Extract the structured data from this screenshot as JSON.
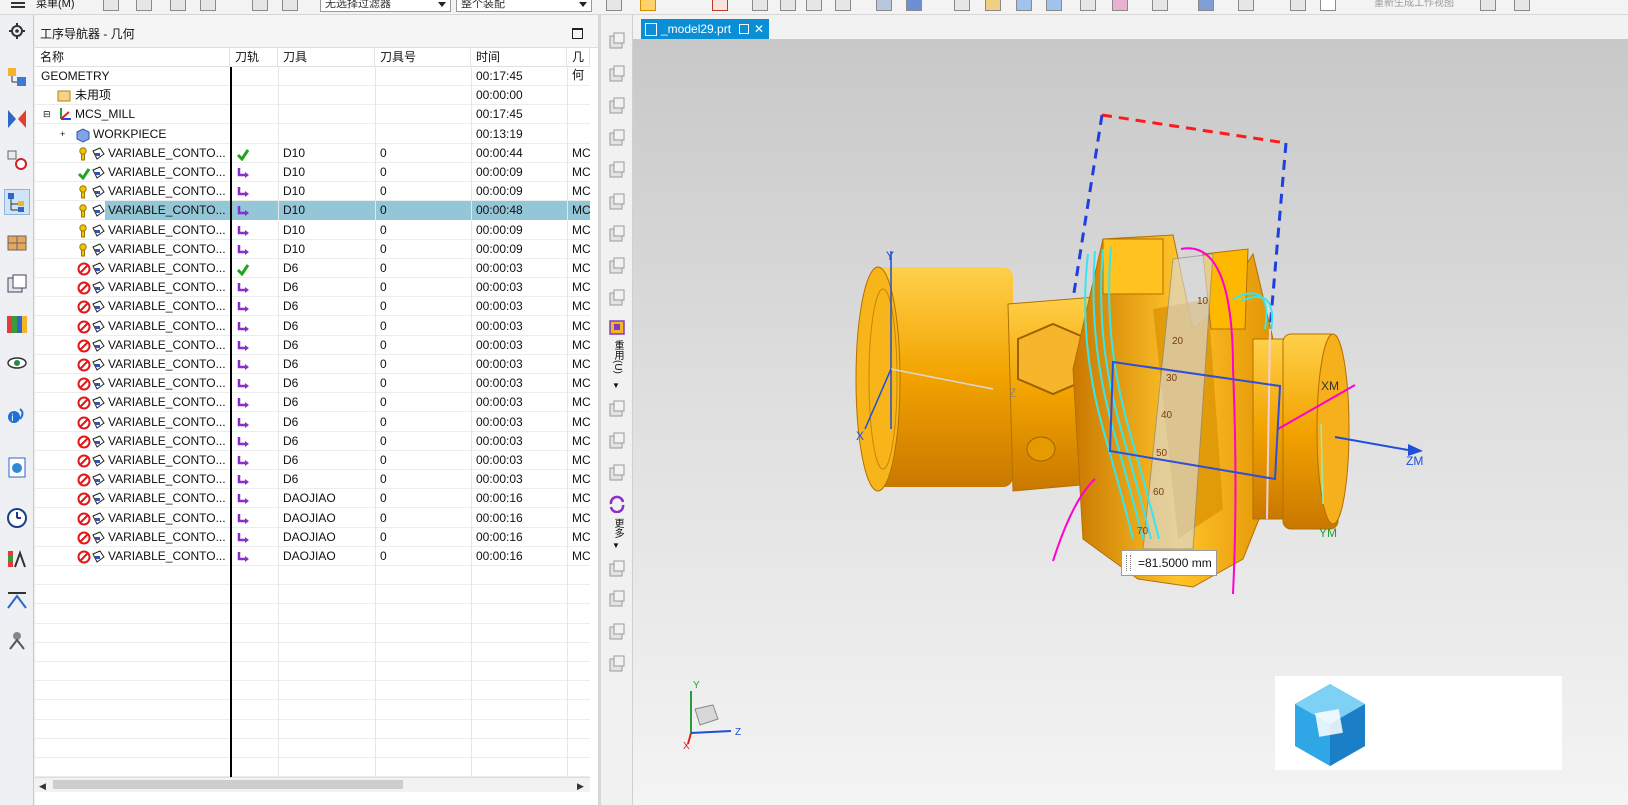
{
  "toolbar": {
    "menu_label": "菜单(M)",
    "filter_select": "无选择过滤器",
    "assembly_select": "整个装配",
    "right_hint": "重新生成工作视图"
  },
  "navigator": {
    "title": "工序导航器 - 几何",
    "columns": [
      "名称",
      "刀轨",
      "刀具",
      "刀具号",
      "时间",
      "几何"
    ],
    "rows": [
      {
        "name": "GEOMETRY",
        "path": "",
        "tool": "",
        "toolno": "",
        "time": "00:17:45",
        "geom": "",
        "level": 0,
        "status": "",
        "type": "root"
      },
      {
        "name": "未用项",
        "path": "",
        "tool": "",
        "toolno": "",
        "time": "00:00:00",
        "geom": "",
        "level": 1,
        "status": "",
        "type": "unused"
      },
      {
        "name": "MCS_MILL",
        "path": "",
        "tool": "",
        "toolno": "",
        "time": "00:17:45",
        "geom": "",
        "level": 1,
        "status": "",
        "type": "mcs"
      },
      {
        "name": "WORKPIECE",
        "path": "",
        "tool": "",
        "toolno": "",
        "time": "00:13:19",
        "geom": "",
        "level": 2,
        "status": "",
        "type": "workpiece"
      },
      {
        "name": "VARIABLE_CONTO...",
        "path": "check",
        "tool": "D10",
        "toolno": "0",
        "time": "00:00:44",
        "geom": "MC",
        "level": 3,
        "status": "warn",
        "type": "op"
      },
      {
        "name": "VARIABLE_CONTO...",
        "path": "arrow",
        "tool": "D10",
        "toolno": "0",
        "time": "00:00:09",
        "geom": "MC",
        "level": 3,
        "status": "ok",
        "type": "op"
      },
      {
        "name": "VARIABLE_CONTO...",
        "path": "arrow",
        "tool": "D10",
        "toolno": "0",
        "time": "00:00:09",
        "geom": "MC",
        "level": 3,
        "status": "warn",
        "type": "op"
      },
      {
        "name": "VARIABLE_CONTO...",
        "path": "arrow",
        "tool": "D10",
        "toolno": "0",
        "time": "00:00:48",
        "geom": "MC",
        "level": 3,
        "status": "warn",
        "type": "op",
        "selected": true
      },
      {
        "name": "VARIABLE_CONTO...",
        "path": "arrow",
        "tool": "D10",
        "toolno": "0",
        "time": "00:00:09",
        "geom": "MC",
        "level": 3,
        "status": "warn",
        "type": "op"
      },
      {
        "name": "VARIABLE_CONTO...",
        "path": "arrow",
        "tool": "D10",
        "toolno": "0",
        "time": "00:00:09",
        "geom": "MC",
        "level": 3,
        "status": "warn",
        "type": "op"
      },
      {
        "name": "VARIABLE_CONTO...",
        "path": "check",
        "tool": "D6",
        "toolno": "0",
        "time": "00:00:03",
        "geom": "MC",
        "level": 3,
        "status": "no",
        "type": "op"
      },
      {
        "name": "VARIABLE_CONTO...",
        "path": "arrow",
        "tool": "D6",
        "toolno": "0",
        "time": "00:00:03",
        "geom": "MC",
        "level": 3,
        "status": "no",
        "type": "op"
      },
      {
        "name": "VARIABLE_CONTO...",
        "path": "arrow",
        "tool": "D6",
        "toolno": "0",
        "time": "00:00:03",
        "geom": "MC",
        "level": 3,
        "status": "no",
        "type": "op"
      },
      {
        "name": "VARIABLE_CONTO...",
        "path": "arrow",
        "tool": "D6",
        "toolno": "0",
        "time": "00:00:03",
        "geom": "MC",
        "level": 3,
        "status": "no",
        "type": "op"
      },
      {
        "name": "VARIABLE_CONTO...",
        "path": "arrow",
        "tool": "D6",
        "toolno": "0",
        "time": "00:00:03",
        "geom": "MC",
        "level": 3,
        "status": "no",
        "type": "op"
      },
      {
        "name": "VARIABLE_CONTO...",
        "path": "arrow",
        "tool": "D6",
        "toolno": "0",
        "time": "00:00:03",
        "geom": "MC",
        "level": 3,
        "status": "no",
        "type": "op"
      },
      {
        "name": "VARIABLE_CONTO...",
        "path": "arrow",
        "tool": "D6",
        "toolno": "0",
        "time": "00:00:03",
        "geom": "MC",
        "level": 3,
        "status": "no",
        "type": "op"
      },
      {
        "name": "VARIABLE_CONTO...",
        "path": "arrow",
        "tool": "D6",
        "toolno": "0",
        "time": "00:00:03",
        "geom": "MC",
        "level": 3,
        "status": "no",
        "type": "op"
      },
      {
        "name": "VARIABLE_CONTO...",
        "path": "arrow",
        "tool": "D6",
        "toolno": "0",
        "time": "00:00:03",
        "geom": "MC",
        "level": 3,
        "status": "no",
        "type": "op"
      },
      {
        "name": "VARIABLE_CONTO...",
        "path": "arrow",
        "tool": "D6",
        "toolno": "0",
        "time": "00:00:03",
        "geom": "MC",
        "level": 3,
        "status": "no",
        "type": "op"
      },
      {
        "name": "VARIABLE_CONTO...",
        "path": "arrow",
        "tool": "D6",
        "toolno": "0",
        "time": "00:00:03",
        "geom": "MC",
        "level": 3,
        "status": "no",
        "type": "op"
      },
      {
        "name": "VARIABLE_CONTO...",
        "path": "arrow",
        "tool": "D6",
        "toolno": "0",
        "time": "00:00:03",
        "geom": "MC",
        "level": 3,
        "status": "no",
        "type": "op"
      },
      {
        "name": "VARIABLE_CONTO...",
        "path": "arrow",
        "tool": "DAOJIAO",
        "toolno": "0",
        "time": "00:00:16",
        "geom": "MC",
        "level": 3,
        "status": "no",
        "type": "op"
      },
      {
        "name": "VARIABLE_CONTO...",
        "path": "arrow",
        "tool": "DAOJIAO",
        "toolno": "0",
        "time": "00:00:16",
        "geom": "MC",
        "level": 3,
        "status": "no",
        "type": "op"
      },
      {
        "name": "VARIABLE_CONTO...",
        "path": "arrow",
        "tool": "DAOJIAO",
        "toolno": "0",
        "time": "00:00:16",
        "geom": "MC",
        "level": 3,
        "status": "no",
        "type": "op"
      },
      {
        "name": "VARIABLE_CONTO...",
        "path": "arrow",
        "tool": "DAOJIAO",
        "toolno": "0",
        "time": "00:00:16",
        "geom": "MC",
        "level": 3,
        "status": "no",
        "type": "op"
      }
    ]
  },
  "side_toolbar": {
    "group1_label": "重用(U)",
    "group2_label": "更多"
  },
  "viewport": {
    "tab_label": "_model29.prt",
    "measure_value": "=81.5000 mm",
    "axis_labels": {
      "xm": "XM",
      "ym": "YM",
      "zm": "ZM",
      "y": "Y",
      "x": "X",
      "z": "Z"
    },
    "triad_labels": {
      "x": "X",
      "y": "Y",
      "z": "Z"
    },
    "ruler_ticks": [
      "10",
      "20",
      "30",
      "40",
      "50",
      "60",
      "70"
    ]
  },
  "colors": {
    "selected_row": "#93c7d8",
    "tab_active": "#0a8fd6",
    "part_orange": "#f2a300",
    "toolpath_cyan": "#35e6f0",
    "toolpath_magenta": "#ff00d0",
    "axis_blue": "#1f4fd8"
  },
  "icons": [
    "settings-icon",
    "part-navigator-icon",
    "assembly-navigator-icon",
    "constraint-navigator-icon",
    "operation-navigator-icon",
    "machine-navigator-icon",
    "reuse-library-icon",
    "history-icon",
    "visibility-icon",
    "roles-icon",
    "web-browser-icon",
    "clock-icon",
    "analysis-icon",
    "system-icon",
    "process-icon"
  ]
}
